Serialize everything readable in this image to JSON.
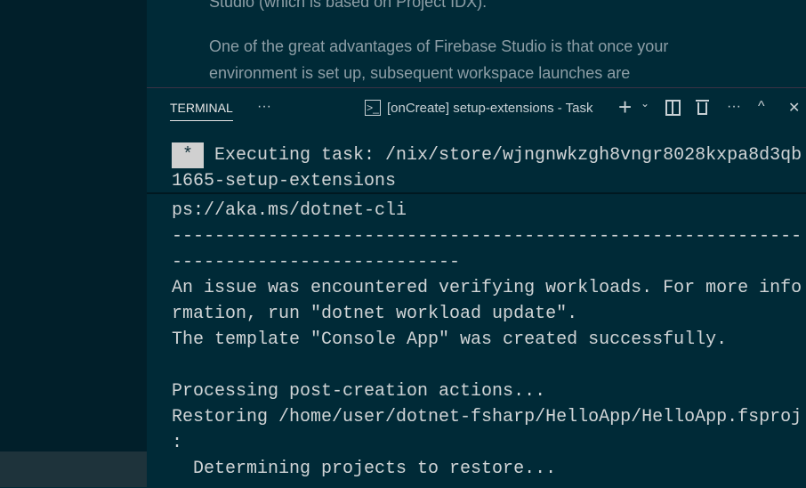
{
  "editor": {
    "lines": [
      "Studio (which is based on Project IDX).",
      "One of the great advantages of Firebase Studio is that once your",
      "environment is set up, subsequent workspace launches are"
    ]
  },
  "panel": {
    "tab_label": "TERMINAL",
    "more_label": "···",
    "terminal_name": "[onCreate] setup-extensions - Task",
    "more_actions": "···"
  },
  "terminal": {
    "star": "*",
    "sticky": [
      "Executing task: /nix/store/wjngnwkzgh8vngr8028kxpa8d3qb",
      "1665-setup-extensions"
    ],
    "lines": [
      "ps://aka.ms/dotnet-cli",
      "-----------------------------------------------------------",
      "---------------------------",
      "An issue was encountered verifying workloads. For more info",
      "rmation, run \"dotnet workload update\".",
      "The template \"Console App\" was created successfully.",
      "",
      "Processing post-creation actions...",
      "Restoring /home/user/dotnet-fsharp/HelloApp/HelloApp.fsproj",
      ":",
      "  Determining projects to restore..."
    ]
  }
}
